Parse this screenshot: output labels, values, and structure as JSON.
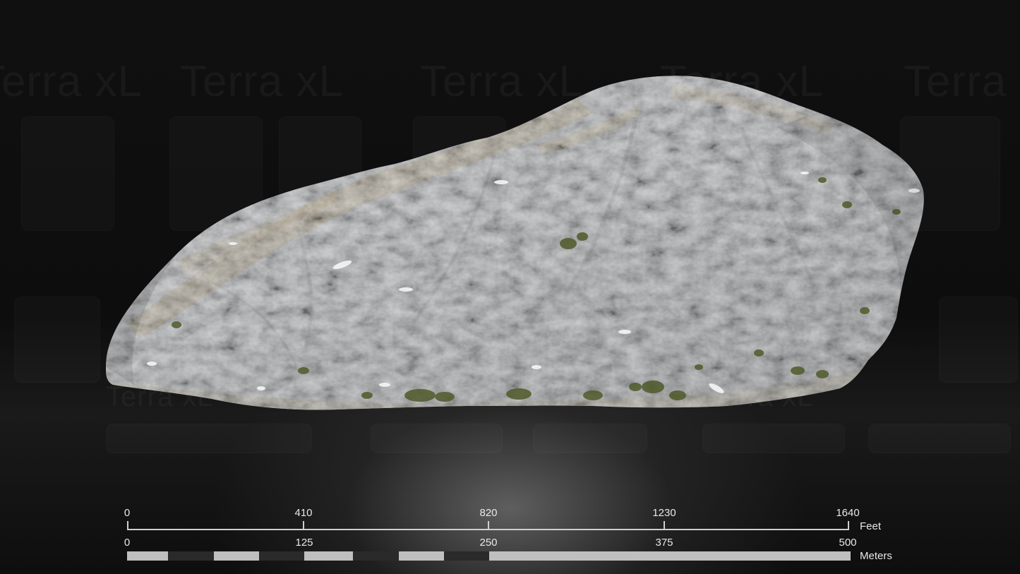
{
  "watermark": {
    "text": "Terra xL"
  },
  "scale": {
    "feet": {
      "ticks": [
        "0",
        "410",
        "820",
        "1230",
        "1640"
      ],
      "unit": "Feet"
    },
    "meters": {
      "ticks": [
        "0",
        "125",
        "250",
        "375",
        "500"
      ],
      "unit": "Meters"
    }
  },
  "colors": {
    "background": "#0b0b0b",
    "rock_base": "#9c9da0",
    "rock_light": "#c9cbcd",
    "rock_dark": "#6b6c6f",
    "grass": "#a08a5c",
    "moss": "#4f5a2a",
    "scale_light": "#bfbfbf",
    "scale_dark": "#2a2a2a",
    "scale_text": "#e8e8e8"
  }
}
